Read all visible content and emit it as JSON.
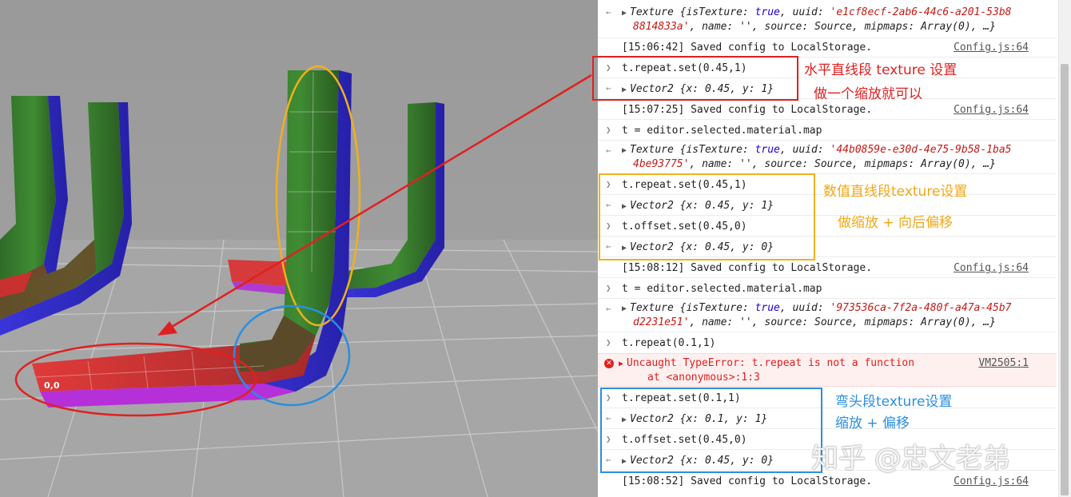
{
  "console": {
    "lines": [
      {
        "texture_prefix": "Texture {isTexture: ",
        "true_val": "true",
        "uuid_label": ", uuid: ",
        "uuid_line1": "'e1cf8ecf-2ab6-44c6-a201-53b8",
        "uuid_line2": "8814833a'",
        "rest": ", name: '', source: Source, mipmaps: Array(0), …}"
      },
      {
        "saved": "[15:06:42] Saved config to LocalStorage.",
        "source": "Config.js:64"
      },
      {
        "input": "t.repeat.set(0.45,1)",
        "output": "Vector2 {x: 0.45, y: 1}"
      },
      {
        "saved": "[15:07:25] Saved config to LocalStorage.",
        "source": "Config.js:64"
      },
      {
        "input": "t = editor.selected.material.map"
      },
      {
        "texture_prefix": "Texture {isTexture: ",
        "true_val": "true",
        "uuid_label": ", uuid: ",
        "uuid_line1": "'44b0859e-e30d-4e75-9b58-1ba5",
        "uuid_line2": "4be93775'",
        "rest": ", name: '', source: Source, mipmaps: Array(0), …}"
      },
      {
        "input": "t.repeat.set(0.45,1)",
        "output": "Vector2 {x: 0.45, y: 1}"
      },
      {
        "input": "t.offset.set(0.45,0)",
        "output": "Vector2 {x: 0.45, y: 0}"
      },
      {
        "saved": "[15:08:12] Saved config to LocalStorage.",
        "source": "Config.js:64"
      },
      {
        "input": "t = editor.selected.material.map"
      },
      {
        "texture_prefix": "Texture {isTexture: ",
        "true_val": "true",
        "uuid_label": ", uuid: ",
        "uuid_line1": "'973536ca-7f2a-480f-a47a-45b7",
        "uuid_line2": "d2231e51'",
        "rest": ", name: '', source: Source, mipmaps: Array(0), …}"
      },
      {
        "input": "t.repeat(0.1,1)"
      },
      {
        "error1": "Uncaught TypeError: t.repeat is not a function",
        "error2": "at <anonymous>:1:3",
        "source": "VM2505:1"
      },
      {
        "input": "t.repeat.set(0.1,1)",
        "output": "Vector2 {x: 0.1, y: 1}"
      },
      {
        "input": "t.offset.set(0.45,0)",
        "output": "Vector2 {x: 0.45, y: 0}"
      },
      {
        "saved": "[15:08:52] Saved config to LocalStorage.",
        "source": "Config.js:64"
      }
    ]
  },
  "annotations": {
    "red_title": "水平直线段 texture 设置",
    "red_sub": "做一个缩放就可以",
    "yellow_title": "数值直线段texture设置",
    "yellow_sub": "做缩放 + 向后偏移",
    "blue_title": "弯头段texture设置",
    "blue_sub": "缩放 + 偏移"
  },
  "watermark": "知乎 @忠文老弟",
  "colors": {
    "red": "#e02020",
    "yellow": "#f0b020",
    "blue": "#2a8ee0",
    "note_red": "#e02020",
    "note_yellow": "#f0a818",
    "note_blue": "#2a8ee0"
  },
  "icons": {
    "prompt": "chevron-right-icon",
    "result": "return-arrow-icon",
    "expand": "triangle-right-icon",
    "error": "error-circle-icon"
  },
  "viewport": {
    "uv_label": "0,0"
  }
}
